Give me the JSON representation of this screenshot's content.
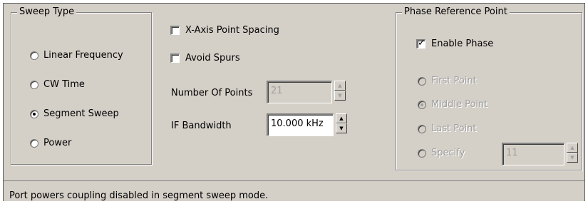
{
  "sweep_type": {
    "title": "Sweep Type",
    "options": [
      {
        "label": "Linear Frequency",
        "selected": false
      },
      {
        "label": "CW Time",
        "selected": false
      },
      {
        "label": "Segment Sweep",
        "selected": true
      },
      {
        "label": "Power",
        "selected": false
      }
    ]
  },
  "options": {
    "x_axis_spacing": {
      "label": "X-Axis Point Spacing",
      "checked": false
    },
    "avoid_spurs": {
      "label": "Avoid Spurs",
      "checked": false
    },
    "number_of_points": {
      "label": "Number Of Points",
      "value": "21",
      "enabled": false
    },
    "if_bandwidth": {
      "label": "IF Bandwidth",
      "value": "10.000 kHz",
      "enabled": true
    }
  },
  "phase_reference": {
    "title": "Phase Reference Point",
    "enable_phase": {
      "label": "Enable Phase",
      "checked": true
    },
    "points": [
      {
        "label": "First Point",
        "selected": false
      },
      {
        "label": "Middle Point",
        "selected": true
      },
      {
        "label": "Last Point",
        "selected": false
      },
      {
        "label": "Specify",
        "selected": false
      }
    ],
    "specify_value": "11"
  },
  "status": {
    "message": "Port powers coupling disabled in segment sweep mode."
  }
}
